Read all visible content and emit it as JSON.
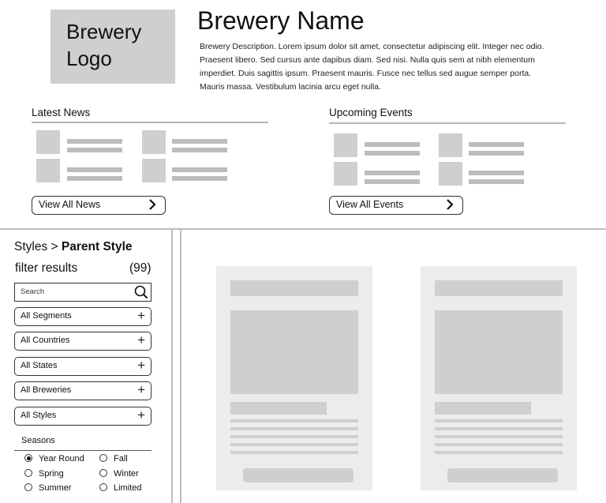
{
  "header": {
    "logo_line1": "Brewery",
    "logo_line2": "Logo",
    "name": "Brewery Name",
    "description": "Brewery Description. Lorem ipsum dolor sit amet, consectetur adipiscing elit. Integer nec odio. Praesent libero. Sed cursus ante dapibus diam. Sed nisi. Nulla quis sem at nibh elementum imperdiet. Duis sagittis ipsum. Praesent mauris. Fusce nec tellus sed augue semper porta. Mauris massa. Vestibulum lacinia arcu eget nulla."
  },
  "news": {
    "title": "Latest News",
    "button_label": "View All News"
  },
  "events": {
    "title": "Upcoming Events",
    "button_label": "View All Events"
  },
  "sidebar": {
    "breadcrumb_root": "Styles",
    "breadcrumb_sep": ">",
    "breadcrumb_current": "Parent Style",
    "filter_label": "filter results",
    "filter_count": "(99)",
    "search_placeholder": "Search",
    "dropdowns": [
      "All Segments",
      "All Countries",
      "All States",
      "All Breweries",
      "All Styles"
    ],
    "seasons_label": "Seasons",
    "seasons": [
      {
        "label": "Year Round",
        "selected": true
      },
      {
        "label": "Spring",
        "selected": false
      },
      {
        "label": "Summer",
        "selected": false
      },
      {
        "label": "Fall",
        "selected": false
      },
      {
        "label": "Winter",
        "selected": false
      },
      {
        "label": "Limited",
        "selected": false
      }
    ]
  },
  "icons": {
    "chevron": "chevron-right-icon",
    "search": "magnifier-icon",
    "plus": "plus-icon"
  },
  "colors": {
    "placeholder_gray": "#cfcfcf",
    "card_bg": "#ececec",
    "border": "#333333"
  }
}
